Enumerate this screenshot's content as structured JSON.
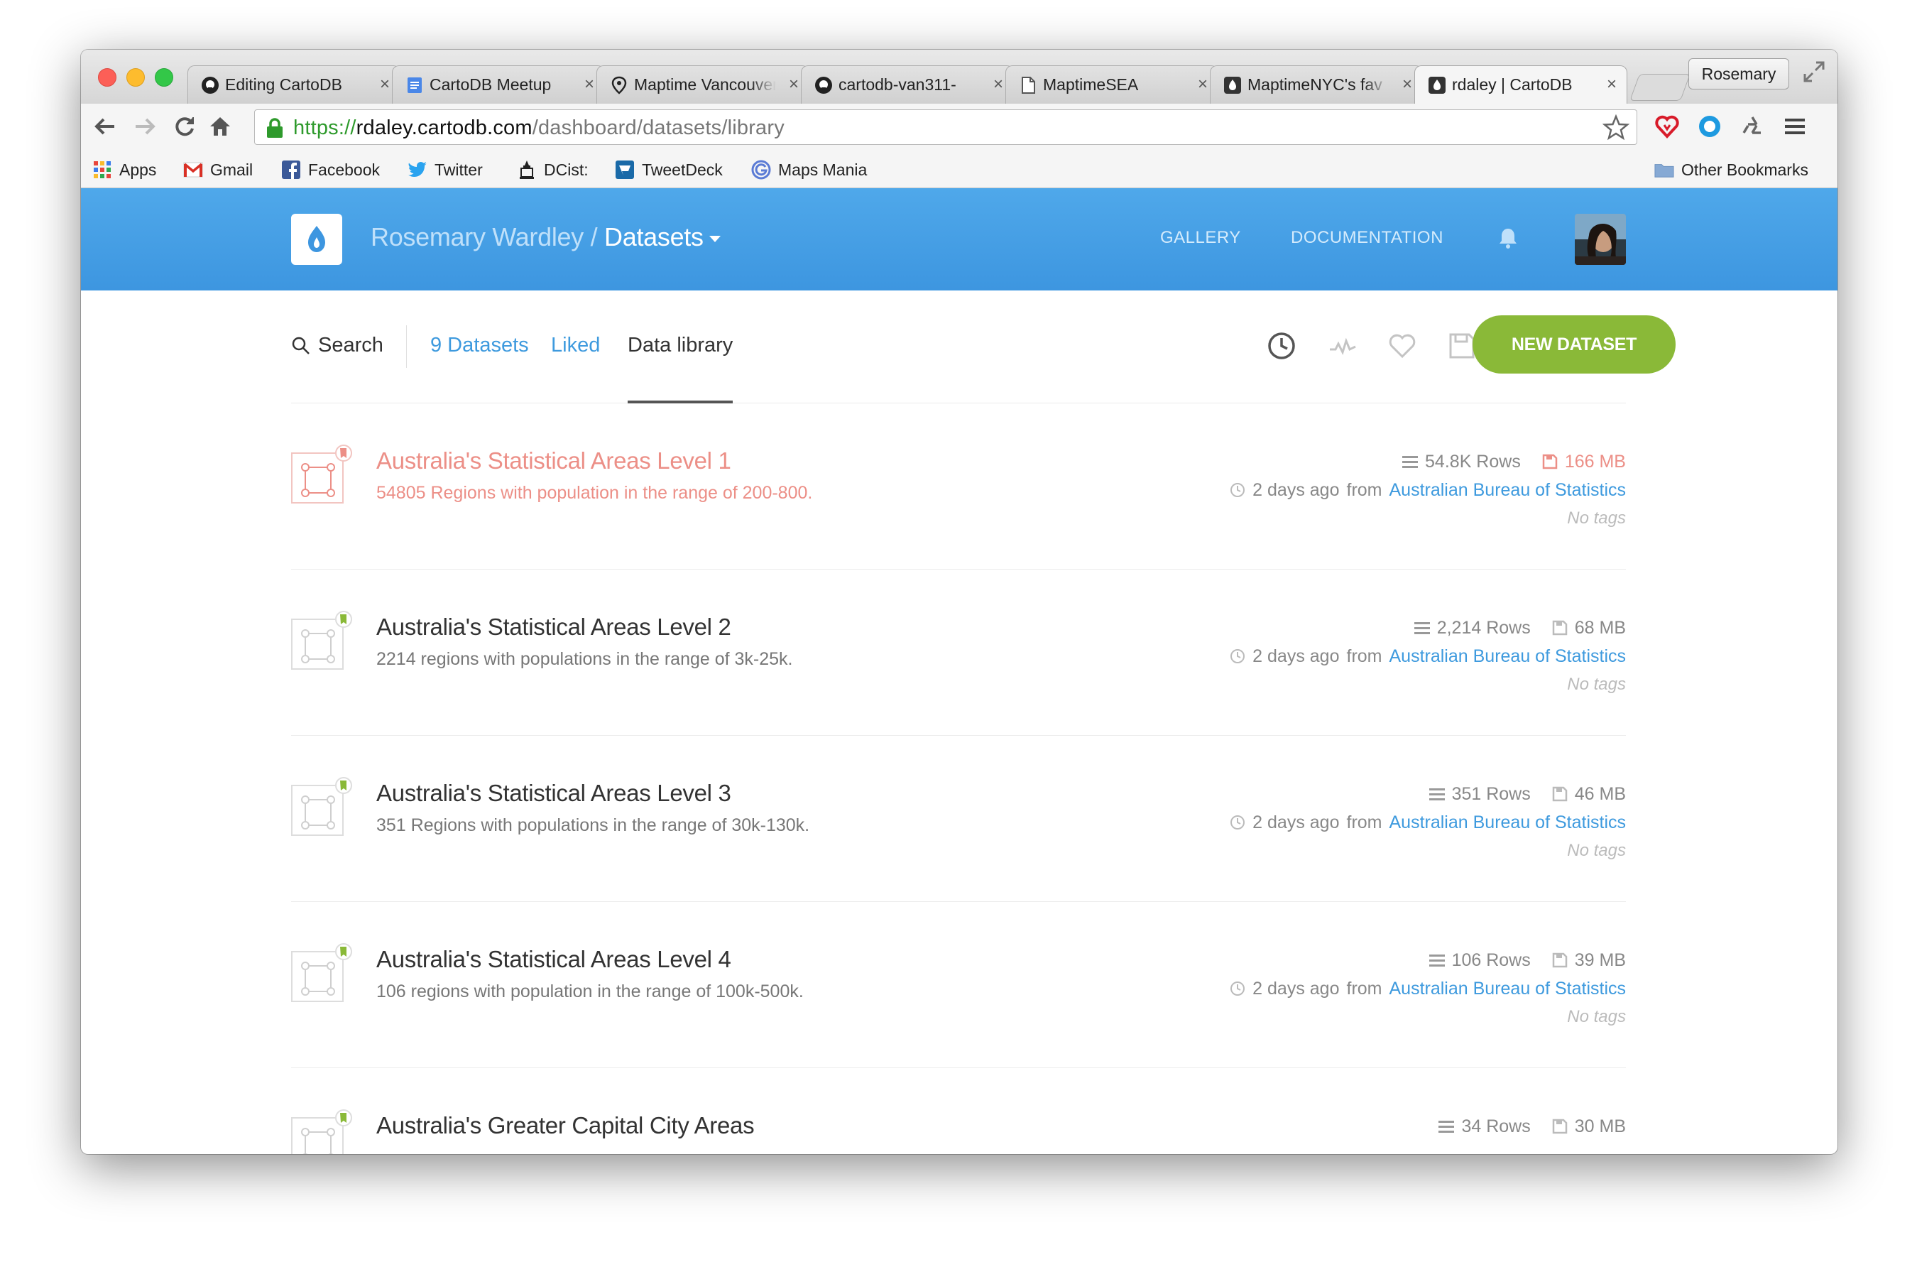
{
  "browser": {
    "tabs": [
      {
        "title": "Editing CartoDB",
        "icon": "github-icon"
      },
      {
        "title": "CartoDB Meetup",
        "icon": "google-doc-icon"
      },
      {
        "title": "Maptime Vancouver",
        "icon": "map-pin-icon"
      },
      {
        "title": "cartodb-van311-",
        "icon": "github-icon"
      },
      {
        "title": "MaptimeSEA",
        "icon": "document-icon"
      },
      {
        "title": "MaptimeNYC's fav",
        "icon": "cartodb-icon"
      },
      {
        "title": "rdaley | CartoDB",
        "icon": "cartodb-icon"
      }
    ],
    "close_glyph": "×",
    "profile_name": "Rosemary",
    "url": {
      "scheme": "https://",
      "host": "rdaley.cartodb.com",
      "path": "/dashboard/datasets/library"
    },
    "bookmarks": [
      {
        "label": "Apps",
        "icon": "apps-grid-icon"
      },
      {
        "label": "Gmail",
        "icon": "gmail-icon"
      },
      {
        "label": "Facebook",
        "icon": "facebook-icon"
      },
      {
        "label": "Twitter",
        "icon": "twitter-icon"
      },
      {
        "label": "DCist:",
        "icon": "dcist-icon"
      },
      {
        "label": "TweetDeck",
        "icon": "tweetdeck-icon"
      },
      {
        "label": "Maps Mania",
        "icon": "maps-mania-icon"
      }
    ],
    "other_bookmarks": "Other Bookmarks"
  },
  "header": {
    "user": "Rosemary Wardley /",
    "section": "Datasets",
    "links": {
      "gallery": "GALLERY",
      "documentation": "DOCUMENTATION"
    }
  },
  "filters": {
    "search": "Search",
    "datasets": "9 Datasets",
    "liked": "Liked",
    "library": "Data library",
    "new_dataset": "NEW DATASET"
  },
  "datasets": [
    {
      "title": "Australia's Statistical Areas Level 1",
      "desc": "54805 Regions with population in the range of 200-800.",
      "rows": "54.8K Rows",
      "size": "166 MB",
      "time": "2 days ago",
      "from": "from",
      "source": "Australian Bureau of Statistics",
      "tags": "No tags",
      "highlight": true
    },
    {
      "title": "Australia's Statistical Areas Level 2",
      "desc": "2214 regions with populations in the range of 3k-25k.",
      "rows": "2,214 Rows",
      "size": "68 MB",
      "time": "2 days ago",
      "from": "from",
      "source": "Australian Bureau of Statistics",
      "tags": "No tags",
      "highlight": false
    },
    {
      "title": "Australia's Statistical Areas Level 3",
      "desc": "351 Regions with populations in the range of 30k-130k.",
      "rows": "351 Rows",
      "size": "46 MB",
      "time": "2 days ago",
      "from": "from",
      "source": "Australian Bureau of Statistics",
      "tags": "No tags",
      "highlight": false
    },
    {
      "title": "Australia's Statistical Areas Level 4",
      "desc": "106 regions with population in the range of 100k-500k.",
      "rows": "106 Rows",
      "size": "39 MB",
      "time": "2 days ago",
      "from": "from",
      "source": "Australian Bureau of Statistics",
      "tags": "No tags",
      "highlight": false
    },
    {
      "title": "Australia's Greater Capital City Areas",
      "desc": "",
      "rows": "34 Rows",
      "size": "30 MB",
      "time": "",
      "from": "",
      "source": "",
      "tags": "",
      "highlight": false
    }
  ],
  "colors": {
    "header_blue": "#4fa8ea",
    "link_blue": "#3e9ade",
    "highlight_pink": "#ec8f87",
    "button_green": "#8ab938",
    "badge_green": "#8ab938"
  }
}
